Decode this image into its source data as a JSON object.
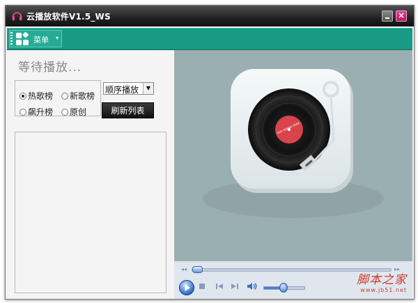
{
  "window": {
    "title": "云播放软件V1.5_WS",
    "close_symbol": "×"
  },
  "menu": {
    "label": "菜单",
    "caret": "▾"
  },
  "status": {
    "text": "等待播放..."
  },
  "charts": [
    {
      "label": "热歌榜",
      "selected": true
    },
    {
      "label": "新歌榜",
      "selected": false
    },
    {
      "label": "飙升榜",
      "selected": false
    },
    {
      "label": "原创",
      "selected": false
    }
  ],
  "order_select": {
    "value": "顺序播放",
    "arrow": "▼"
  },
  "refresh_button": {
    "label": "刷新列表"
  },
  "player": {
    "seek_left": "◂◂",
    "seek_right": "▸▸",
    "icons": [
      "play-icon",
      "stop-icon",
      "previous-icon",
      "next-icon",
      "volume-icon"
    ],
    "seek_progress": 0.02,
    "volume_level": 0.55
  },
  "artwork": {
    "record_label": "SHA NIBNIA YEAR"
  },
  "watermark": {
    "main": "脚本之家",
    "sub": "www.jb51.net"
  },
  "colors": {
    "titlebar": "#222222",
    "menubar": "#179a86",
    "video_bg": "#9aafb1",
    "accent_close": "#d0237a"
  }
}
